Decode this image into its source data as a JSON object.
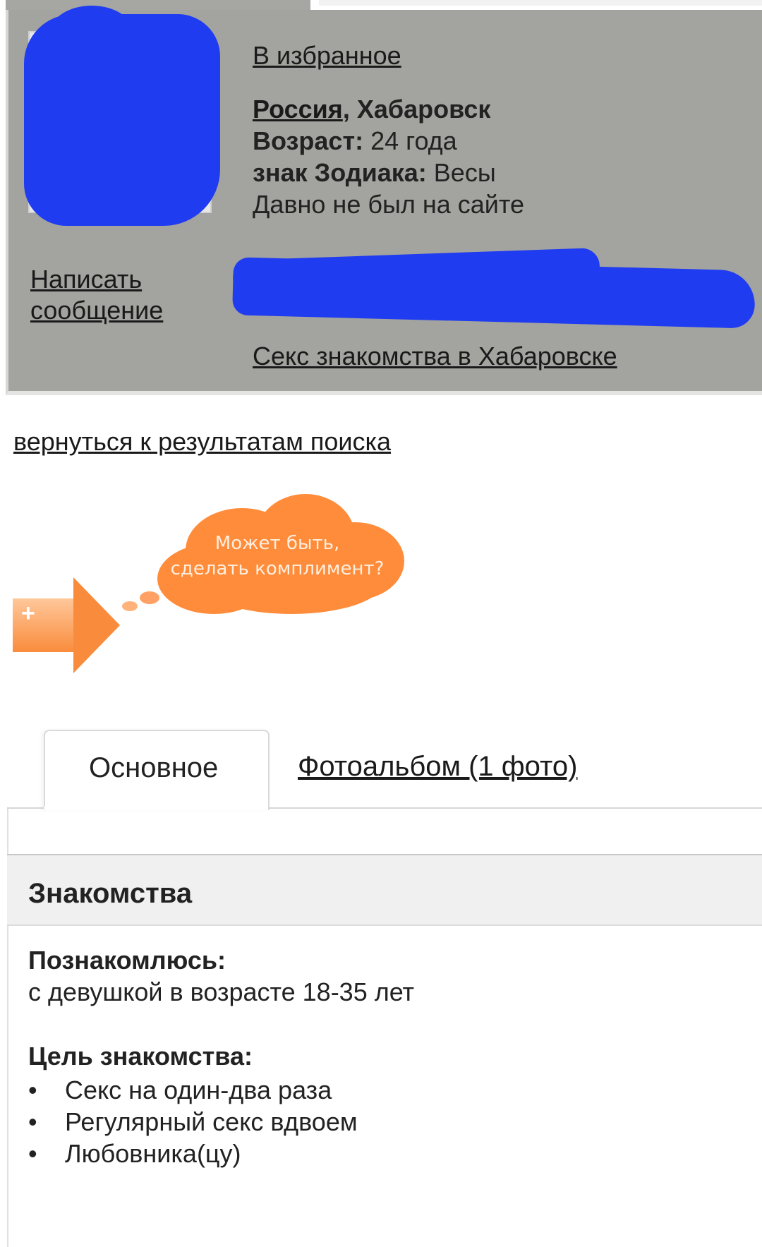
{
  "profile": {
    "favorites_link": "В избранное",
    "location_country": "Россия",
    "location_city": ", Хабаровск",
    "age_label": "Возраст:",
    "age_value": " 24 года",
    "zodiac_label": "знак Зодиака:",
    "zodiac_value": " Весы",
    "last_seen": "Давно не был на сайте",
    "write_message_line1": "Написать",
    "write_message_line2": "сообщение",
    "city_dating_link": "Секс знакомства в Хабаровске"
  },
  "navigation": {
    "back_to_results": "вернуться к результатам поиска"
  },
  "compliment": {
    "line1": "Может быть,",
    "line2": "сделать комплимент?",
    "plus_symbol": "+"
  },
  "tabs": [
    {
      "label": "Основное",
      "active": true
    },
    {
      "label": "Фотоальбом (1 фото)",
      "active": false
    }
  ],
  "section": {
    "title": "Знакомства",
    "seeking_label": "Познакомлюсь:",
    "seeking_value": "с девушкой в возрасте 18-35 лет",
    "goal_label": "Цель знакомства:",
    "goals": [
      "Секс на один-два раза",
      "Регулярный секс вдвоем",
      "Любовника(цу)"
    ]
  },
  "colors": {
    "card_bg": "#a3a39f",
    "redaction": "#1f3cf0",
    "accent_orange": "#ff8c3a"
  }
}
